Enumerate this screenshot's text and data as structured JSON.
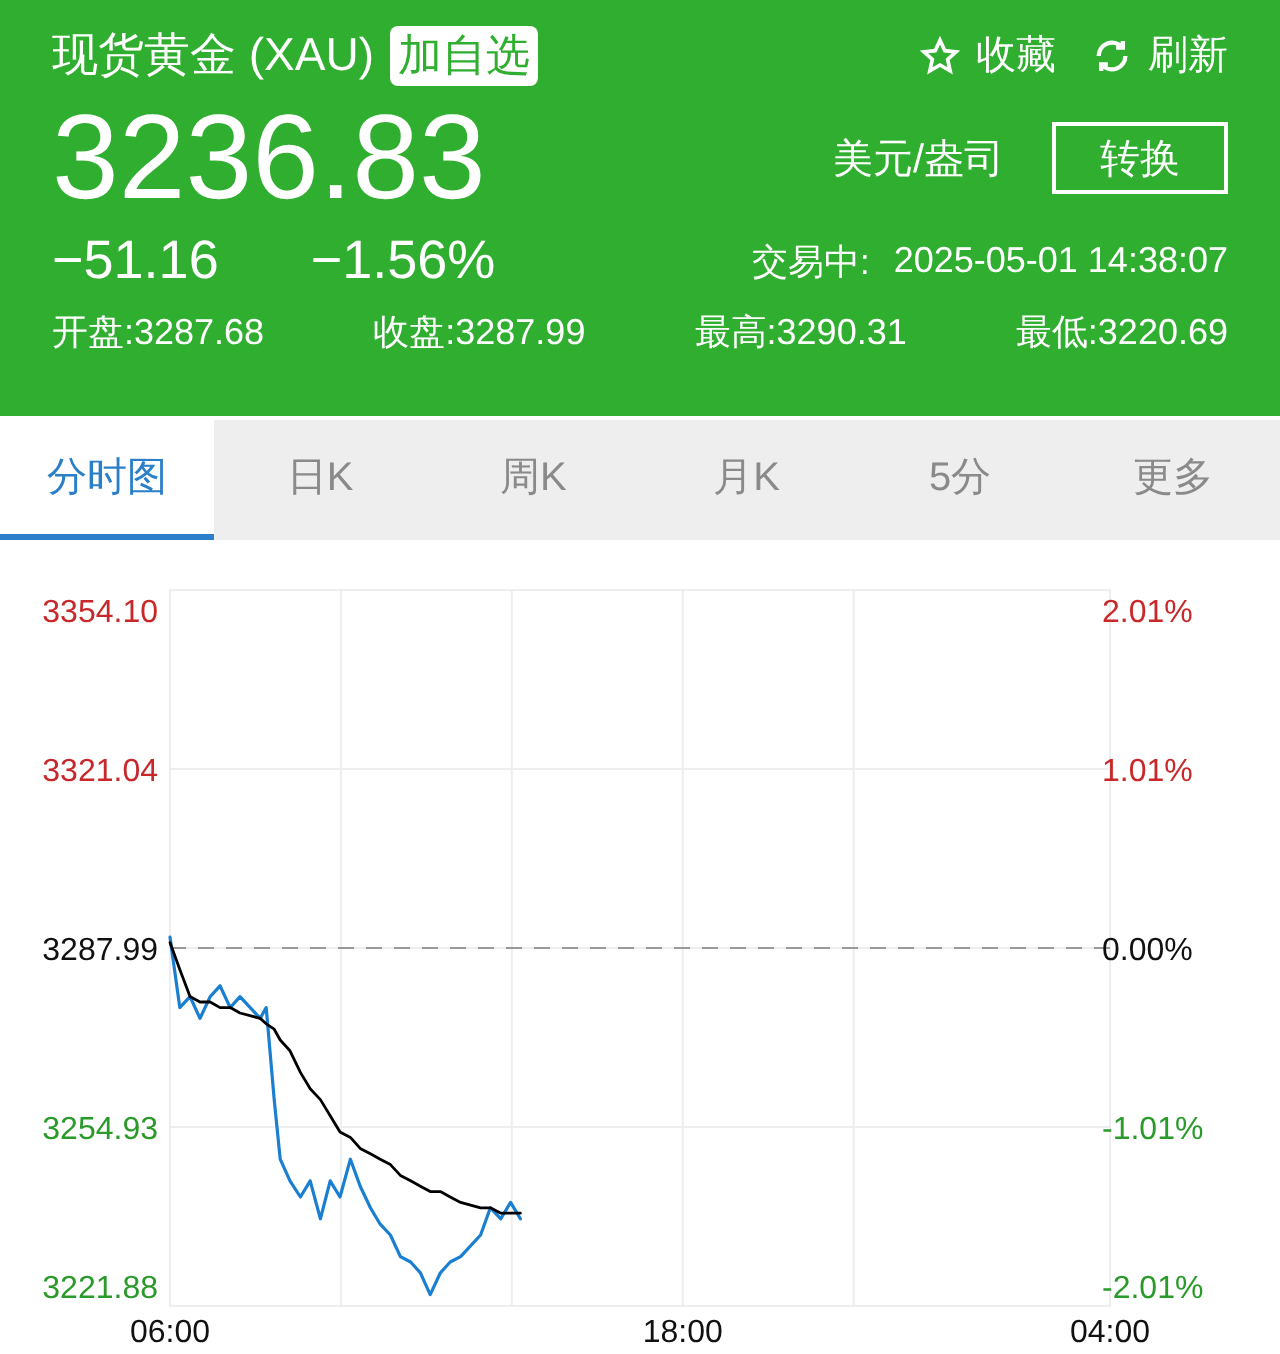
{
  "header": {
    "title": "现货黄金 (XAU)",
    "watchlist_button": "加自选",
    "actions": [
      {
        "kind": "favorite",
        "label": "收藏"
      },
      {
        "kind": "refresh",
        "label": "刷新"
      }
    ],
    "price": "3236.83",
    "unit": "美元/盎司",
    "convert_button": "转换",
    "change": "−51.16",
    "change_percent": "−1.56%",
    "status": "交易中:",
    "timestamp": "2025-05-01 14:38:07",
    "stats": [
      "开盘:3287.68",
      "收盘:3287.99",
      "最高:3290.31",
      "最低:3220.69"
    ]
  },
  "tabs": [
    {
      "label": "分时图",
      "selected": true
    },
    {
      "label": "日K",
      "selected": false
    },
    {
      "label": "周K",
      "selected": false
    },
    {
      "label": "月K",
      "selected": false
    },
    {
      "label": "5分",
      "selected": false
    },
    {
      "label": "更多",
      "selected": false
    }
  ],
  "chart": {
    "next_day_label": "04:00",
    "percent_ticks": [
      {
        "label": "2.01%",
        "color": "#c8282a"
      },
      {
        "label": "1.01%",
        "color": "#c8282a"
      },
      {
        "label": "0.00%",
        "color": "#111111"
      },
      {
        "label": "-1.01%",
        "color": "#2a9a2a"
      },
      {
        "label": "-2.01%",
        "color": "#2a9a2a"
      }
    ],
    "chart_data": {
      "type": "line",
      "grid": true,
      "x": [
        6,
        6.23,
        6.47,
        6.7,
        6.94,
        7.17,
        7.41,
        7.64,
        8.11,
        8.25,
        8.44,
        8.58,
        8.81,
        9.05,
        9.28,
        9.52,
        9.75,
        9.98,
        10.22,
        10.45,
        10.69,
        10.92,
        11.16,
        11.39,
        11.63,
        11.86,
        12.09,
        12.33,
        12.56,
        12.8,
        13.27,
        13.5,
        13.74,
        13.97,
        14.2
      ],
      "series": [
        {
          "color": "#1a7fd0",
          "values": [
            3290,
            3277,
            3279,
            3275,
            3279,
            3281,
            3277,
            3279,
            3275,
            3277,
            3260,
            3249,
            3245,
            3242,
            3245,
            3238,
            3245,
            3242,
            3249,
            3244,
            3240,
            3237,
            3235,
            3231,
            3230,
            3228,
            3224,
            3228,
            3230,
            3231,
            3235,
            3240,
            3238,
            3241,
            3238
          ]
        },
        {
          "color": "#000000",
          "values": [
            3289,
            3284,
            3279,
            3278,
            3278,
            3277,
            3277,
            3276,
            3275,
            3274,
            3273,
            3271,
            3269,
            3265,
            3262,
            3260,
            3257,
            3254,
            3253,
            3251,
            3250,
            3249,
            3248,
            3246,
            3245,
            3244,
            3243,
            3243,
            3242,
            3241,
            3240,
            3240,
            3239,
            3239,
            3239
          ]
        }
      ],
      "ref_lines": [
        {
          "axis": "y",
          "value": 3287.99
        }
      ],
      "xticks": [
        {
          "value": 6,
          "label": "06:00"
        },
        {
          "value": 18,
          "label": "18:00"
        }
      ],
      "xlim": [
        6,
        28
      ],
      "ylim": [
        3221.88,
        3354.1
      ],
      "yticks": [
        {
          "value": 3354.1,
          "label": "3354.10"
        },
        {
          "value": 3321.04,
          "label": "3321.04"
        },
        {
          "value": 3287.99,
          "label": "3287.99"
        },
        {
          "value": 3254.93,
          "label": "3254.93"
        },
        {
          "value": 3221.88,
          "label": "3221.88"
        }
      ]
    }
  }
}
